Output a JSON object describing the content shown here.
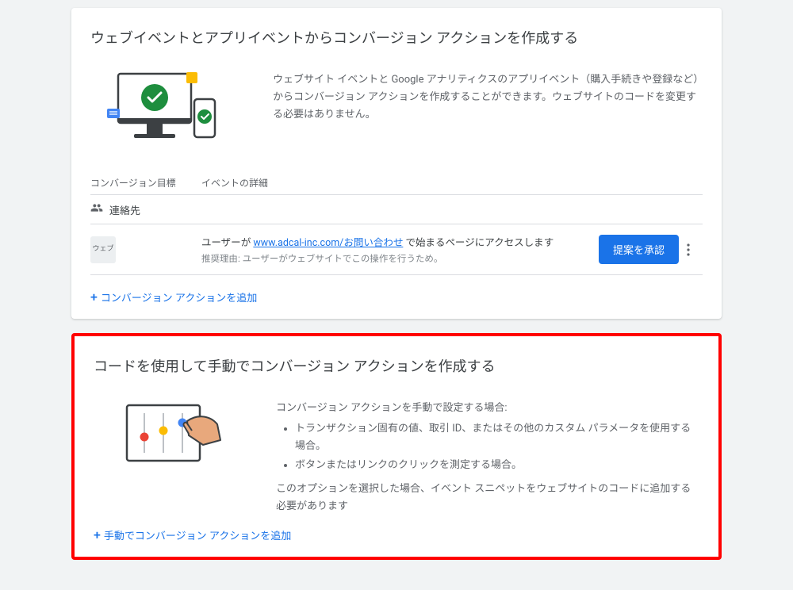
{
  "card1": {
    "title": "ウェブイベントとアプリイベントからコンバージョン アクションを作成する",
    "description": "ウェブサイト イベントと Google アナリティクスのアプリイベント（購入手続きや登録など）からコンバージョン アクションを作成することができます。ウェブサイトのコードを変更する必要はありません。",
    "head_goal": "コンバージョン目標",
    "head_detail": "イベントの詳細",
    "goal_label": "連絡先",
    "web_badge": "ウェブ",
    "detail_prefix": "ユーザーが ",
    "detail_link": "www.adcal-inc.com/お問い合わせ",
    "detail_suffix": " で始まるページにアクセスします",
    "detail_reason": "推奨理由: ユーザーがウェブサイトでこの操作を行うため。",
    "approve_btn": "提案を承認",
    "add_link": "コンバージョン アクションを追加"
  },
  "card2": {
    "title": "コードを使用して手動でコンバージョン アクションを作成する",
    "desc_intro": "コンバージョン アクションを手動で設定する場合:",
    "bullet1": "トランザクション固有の値、取引 ID、またはその他のカスタム パラメータを使用する場合。",
    "bullet2": "ボタンまたはリンクのクリックを測定する場合。",
    "desc_note": "このオプションを選択した場合、イベント スニペットをウェブサイトのコードに追加する必要があります",
    "add_link": "手動でコンバージョン アクションを追加"
  }
}
